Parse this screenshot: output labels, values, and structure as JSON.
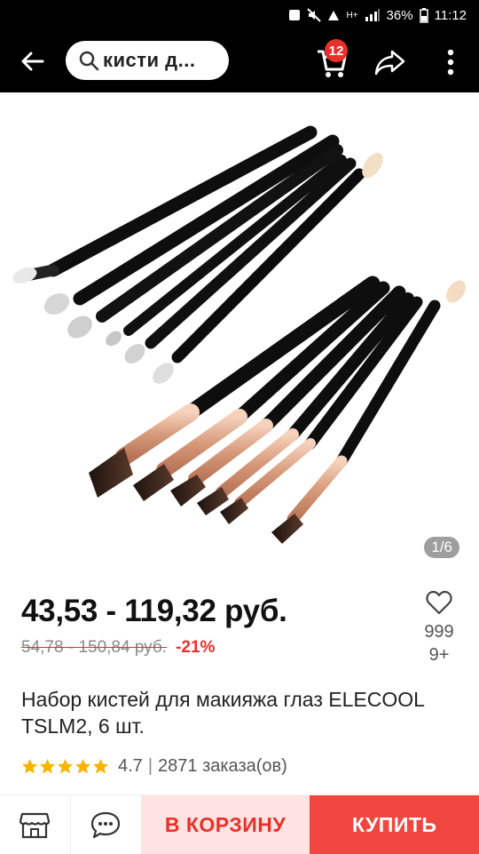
{
  "status_bar": {
    "battery": "36%",
    "time": "11:12",
    "network_label": "H+"
  },
  "topbar": {
    "search_text": "кисти д...",
    "cart_count": "12",
    "icons": [
      "back-arrow-icon",
      "search-icon",
      "cart-icon",
      "share-icon",
      "more-vertical-icon"
    ]
  },
  "gallery": {
    "counter": "1/6"
  },
  "product": {
    "price": "43,53 - 119,32 руб.",
    "old_price": "54,78 - 150,84 руб.",
    "discount": "-21%",
    "wishlist_count_line1": "999",
    "wishlist_count_line2": "9+",
    "title": "Набор кистей для макияжа глаз ELECOOL TSLM2, 6 шт.",
    "rating_value": "4.7",
    "rating_stars": 5,
    "orders": "2871 заказа(ов)"
  },
  "bottom_bar": {
    "add_to_cart_label": "В КОРЗИНУ",
    "buy_label": "КУПИТЬ",
    "icons": [
      "store-icon",
      "chat-icon"
    ]
  },
  "colors": {
    "accent_red": "#e8302b",
    "buy_button": "#f0463f",
    "cart_button_bg": "#fde4e2",
    "header": "#000000"
  }
}
